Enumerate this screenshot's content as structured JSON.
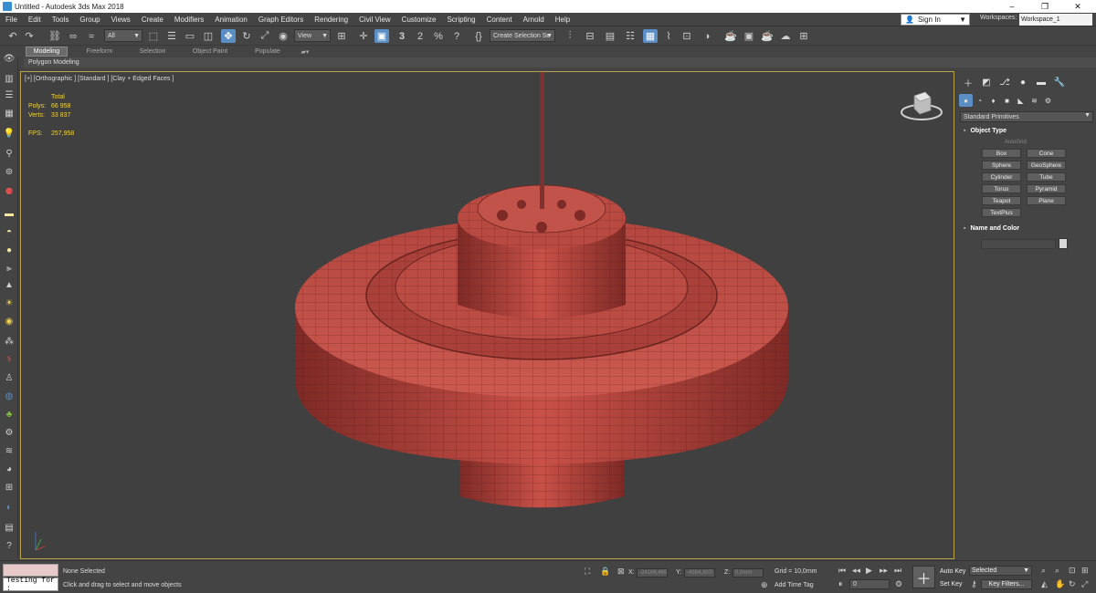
{
  "window": {
    "title": "Untitled - Autodesk 3ds Max 2018",
    "minimize": "–",
    "restore": "❐",
    "close": "✕"
  },
  "menu": {
    "items": [
      "File",
      "Edit",
      "Tools",
      "Group",
      "Views",
      "Create",
      "Modifiers",
      "Animation",
      "Graph Editors",
      "Rendering",
      "Civil View",
      "Customize",
      "Scripting",
      "Content",
      "Arnold",
      "Help"
    ],
    "signin": "Sign In",
    "workspaces_label": "Workspaces:",
    "workspace_value": "Workspace_1"
  },
  "toolbar": {
    "selection_filter": "All",
    "ref_coord": "View",
    "named_selection": "Create Selection Se",
    "snaps_label": "3",
    "angle_snap": "2",
    "percent_snap": "%",
    "spinner_snap": "?"
  },
  "ribbon": {
    "tabs": [
      "Modeling",
      "Freeform",
      "Selection",
      "Object Paint",
      "Populate"
    ],
    "active_tab": "Modeling",
    "sub_label": "Polygon Modeling"
  },
  "viewport": {
    "label": "[+] [Orthographic ] [Standard ] [Clay + Edged Faces ]",
    "stats": {
      "total_label": "Total",
      "polys_label": "Polys:",
      "polys_value": "66 958",
      "verts_label": "Verts:",
      "verts_value": "33 837",
      "fps_label": "FPS:",
      "fps_value": "257,958"
    },
    "model_color": "#c85148"
  },
  "command_panel": {
    "category": "Standard Primitives",
    "object_type_title": "Object Type",
    "autogrid": "AutoGrid",
    "buttons": [
      "Box",
      "Cone",
      "Sphere",
      "GeoSphere",
      "Cylinder",
      "Tube",
      "Torus",
      "Pyramid",
      "Teapot",
      "Plane",
      "TextPlus"
    ],
    "name_color_title": "Name and Color"
  },
  "status": {
    "maxscript_text": "Testing for :",
    "none_selected": "None Selected",
    "prompt": "Click and drag to select and move objects",
    "x_label": "X:",
    "x_value": "-24166,465",
    "y_label": "Y:",
    "y_value": "-4384,307i",
    "z_label": "Z:",
    "z_value": "0,0mm",
    "grid": "Grid = 10,0mm",
    "add_time_tag": "Add Time Tag",
    "auto_key": "Auto Key",
    "set_key": "Set Key",
    "selected": "Selected",
    "key_filters": "Key Filters...",
    "frame": "0"
  }
}
